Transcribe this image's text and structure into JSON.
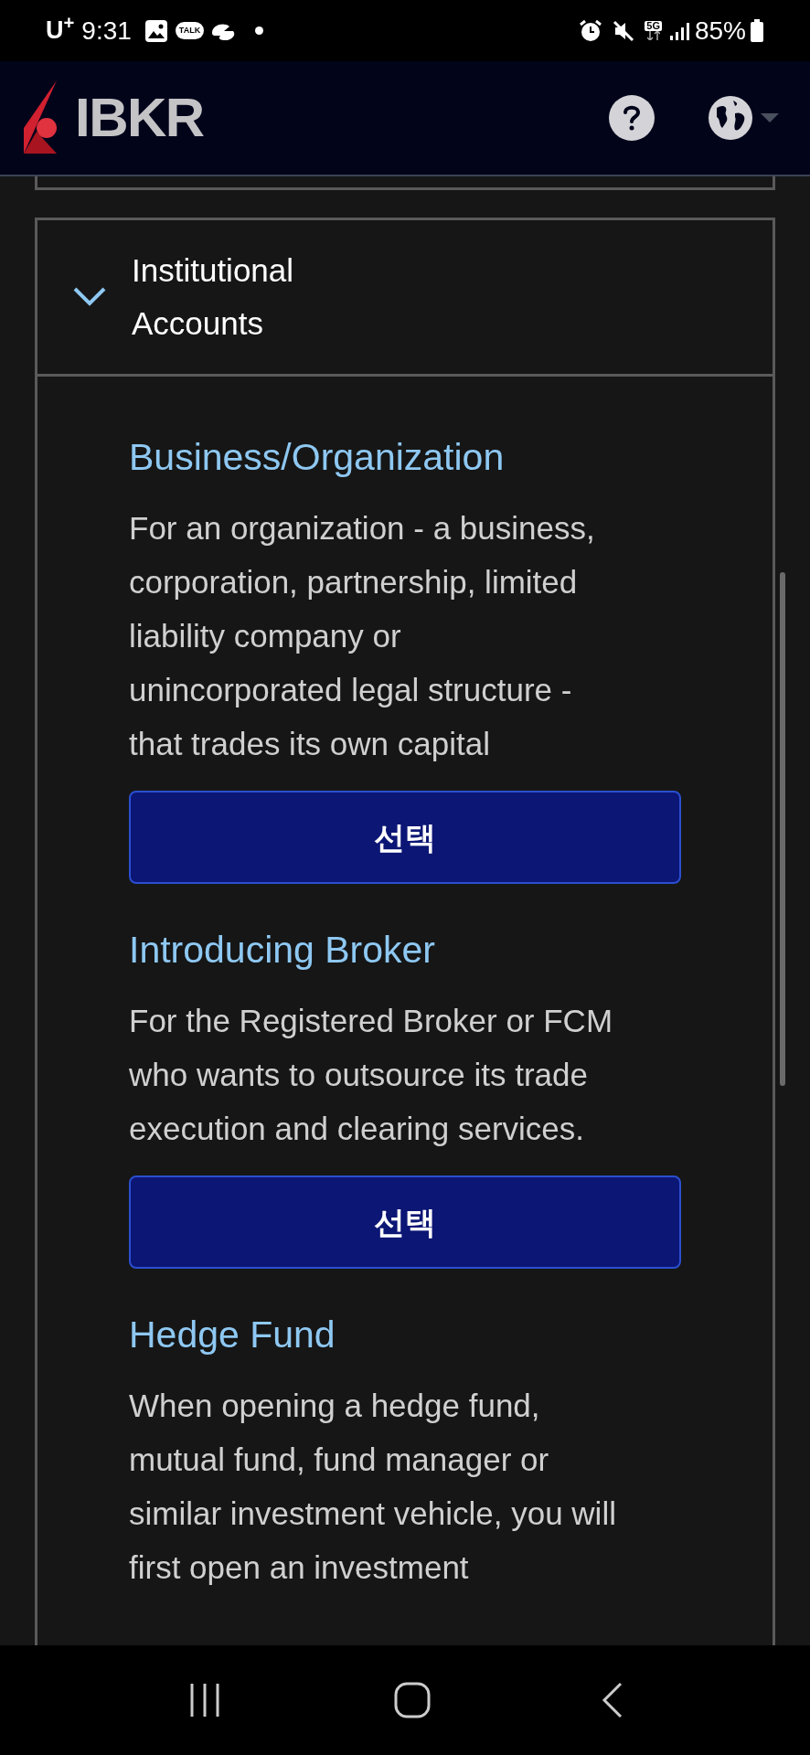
{
  "status_bar": {
    "carrier": "U$^{+}$",
    "time": "9:31",
    "chat_label": "TALK",
    "network": "5G",
    "battery": "85%"
  },
  "header": {
    "logo_text": "IBKR"
  },
  "accordion": {
    "title": "Institutional\nAccounts",
    "expanded": true,
    "options": [
      {
        "title": "Business/Organization",
        "description": "For an organization - a business,\ncorporation, partnership, limited\nliability company or\nunincorporated legal structure -\nthat trades its own capital",
        "button": "선택"
      },
      {
        "title": "Introducing Broker",
        "description": "For the Registered Broker or FCM\nwho wants to outsource its trade\nexecution and clearing services.",
        "button": "선택"
      },
      {
        "title": "Hedge Fund",
        "description": "When opening a hedge fund,\nmutual fund, fund manager or\nsimilar investment vehicle, you will\nfirst open an investment"
      }
    ]
  }
}
